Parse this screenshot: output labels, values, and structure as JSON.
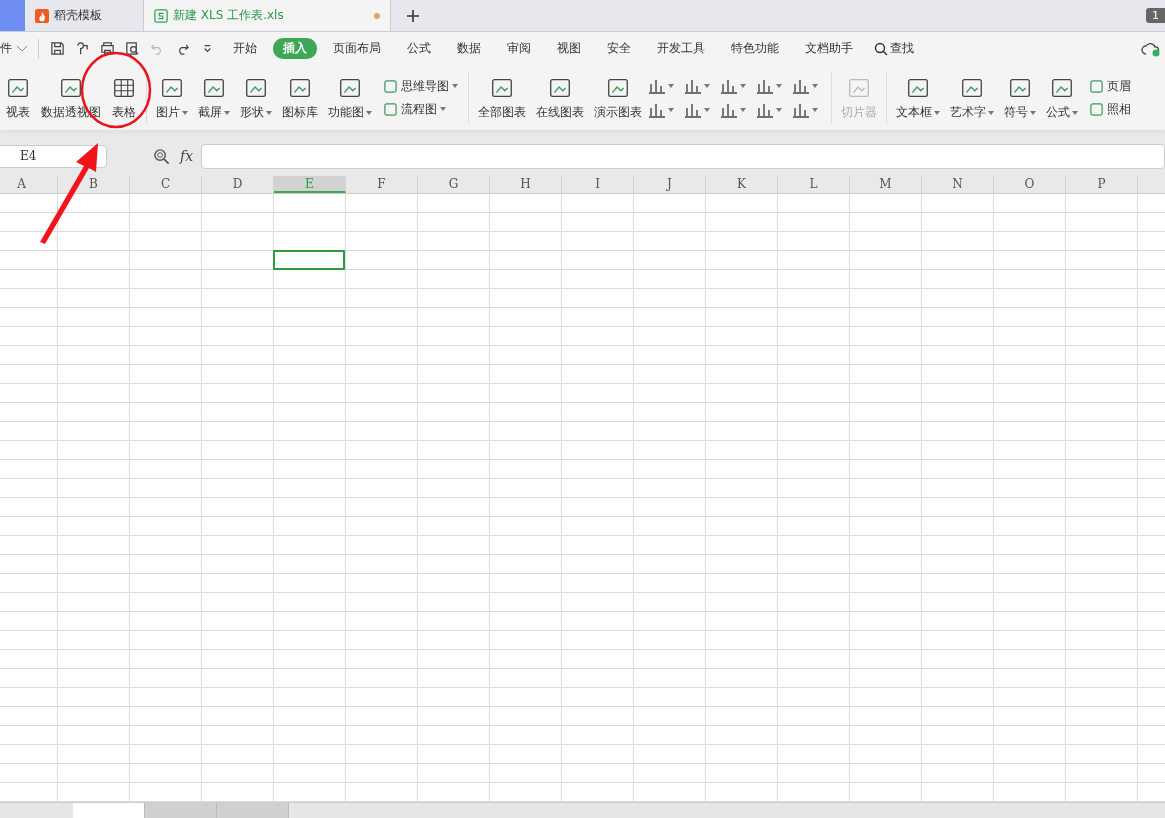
{
  "tabs": [
    {
      "label": "稻壳模板",
      "selected": false,
      "unsaved": false
    },
    {
      "label": "新建 XLS 工作表.xls",
      "selected": true,
      "unsaved": true
    }
  ],
  "window_badge": "1",
  "menu": {
    "file": "件",
    "tabs": [
      {
        "label": "开始",
        "selected": false
      },
      {
        "label": "插入",
        "selected": true
      },
      {
        "label": "页面布局",
        "selected": false
      },
      {
        "label": "公式",
        "selected": false
      },
      {
        "label": "数据",
        "selected": false
      },
      {
        "label": "审阅",
        "selected": false
      },
      {
        "label": "视图",
        "selected": false
      },
      {
        "label": "安全",
        "selected": false
      },
      {
        "label": "开发工具",
        "selected": false
      },
      {
        "label": "特色功能",
        "selected": false
      },
      {
        "label": "文档助手",
        "selected": false
      }
    ],
    "search": "查找"
  },
  "ribbon": [
    {
      "kind": "big",
      "label": "视表",
      "dropdown": false,
      "disabled": false
    },
    {
      "kind": "big",
      "label": "数据透视图",
      "dropdown": false,
      "disabled": false
    },
    {
      "kind": "big",
      "label": "表格",
      "dropdown": false,
      "disabled": false
    },
    {
      "kind": "sep"
    },
    {
      "kind": "big",
      "label": "图片",
      "dropdown": true,
      "disabled": false
    },
    {
      "kind": "big",
      "label": "截屏",
      "dropdown": true,
      "disabled": false
    },
    {
      "kind": "big",
      "label": "形状",
      "dropdown": true,
      "disabled": false
    },
    {
      "kind": "big",
      "label": "图标库",
      "dropdown": false,
      "disabled": false
    },
    {
      "kind": "big",
      "label": "功能图",
      "dropdown": true,
      "disabled": false
    },
    {
      "kind": "small",
      "items": [
        {
          "label": "思维导图",
          "dropdown": true
        },
        {
          "label": "流程图",
          "dropdown": true
        }
      ]
    },
    {
      "kind": "sep"
    },
    {
      "kind": "big",
      "label": "全部图表",
      "dropdown": false,
      "disabled": false
    },
    {
      "kind": "big",
      "label": "在线图表",
      "dropdown": false,
      "disabled": false
    },
    {
      "kind": "big",
      "label": "演示图表",
      "dropdown": false,
      "disabled": false
    },
    {
      "kind": "charts"
    },
    {
      "kind": "sep"
    },
    {
      "kind": "big",
      "label": "切片器",
      "dropdown": false,
      "disabled": true
    },
    {
      "kind": "sep"
    },
    {
      "kind": "big",
      "label": "文本框",
      "dropdown": true,
      "disabled": false
    },
    {
      "kind": "big",
      "label": "艺术字",
      "dropdown": true,
      "disabled": false
    },
    {
      "kind": "big",
      "label": "符号",
      "dropdown": true,
      "disabled": false
    },
    {
      "kind": "big",
      "label": "公式",
      "dropdown": true,
      "disabled": false
    },
    {
      "kind": "small",
      "items": [
        {
          "label": "页眉",
          "dropdown": false
        },
        {
          "label": "照相",
          "dropdown": false
        }
      ]
    }
  ],
  "formula_bar": {
    "name_box": "E4",
    "fx": "fx"
  },
  "columns": [
    {
      "label": "A",
      "selected": false
    },
    {
      "label": "B",
      "selected": false
    },
    {
      "label": "C",
      "selected": false
    },
    {
      "label": "D",
      "selected": false
    },
    {
      "label": "E",
      "selected": true
    },
    {
      "label": "F",
      "selected": false
    },
    {
      "label": "G",
      "selected": false
    },
    {
      "label": "H",
      "selected": false
    },
    {
      "label": "I",
      "selected": false
    },
    {
      "label": "J",
      "selected": false
    },
    {
      "label": "K",
      "selected": false
    },
    {
      "label": "L",
      "selected": false
    },
    {
      "label": "M",
      "selected": false
    },
    {
      "label": "N",
      "selected": false
    },
    {
      "label": "O",
      "selected": false
    },
    {
      "label": "P",
      "selected": false
    }
  ],
  "rows": [
    {
      "selected": false
    },
    {
      "selected": false
    },
    {
      "selected": false
    },
    {
      "selected": true
    },
    {
      "selected": false
    },
    {
      "selected": false
    },
    {
      "selected": false
    },
    {
      "selected": false
    },
    {
      "selected": false
    },
    {
      "selected": false
    },
    {
      "selected": false
    },
    {
      "selected": false
    },
    {
      "selected": false
    },
    {
      "selected": false
    },
    {
      "selected": false
    },
    {
      "selected": false
    },
    {
      "selected": false
    },
    {
      "selected": false
    },
    {
      "selected": false
    },
    {
      "selected": false
    },
    {
      "selected": false
    },
    {
      "selected": false
    },
    {
      "selected": false
    },
    {
      "selected": false
    },
    {
      "selected": false
    },
    {
      "selected": false
    },
    {
      "selected": false
    },
    {
      "selected": false
    },
    {
      "selected": false
    },
    {
      "selected": false
    },
    {
      "selected": false
    },
    {
      "selected": false
    }
  ],
  "sheet_tabs": [
    {
      "selected": true
    },
    {
      "selected": false
    },
    {
      "selected": false
    }
  ]
}
